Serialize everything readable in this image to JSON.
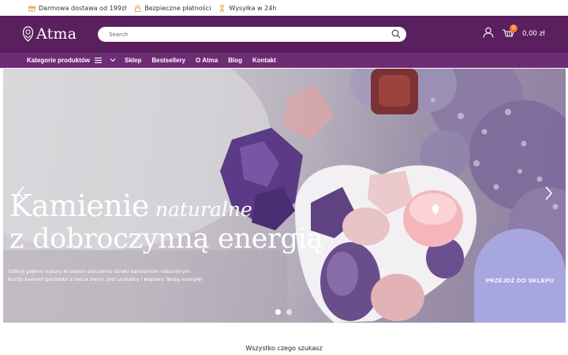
{
  "infobar": {
    "items": [
      {
        "label": "Darmowa dostawa od 199zł",
        "icon": "gift-icon"
      },
      {
        "label": "Bezpieczne płatności",
        "icon": "lock-icon"
      },
      {
        "label": "Wysyłka w 24h",
        "icon": "hourglass-icon"
      }
    ],
    "icon_color": "#e3a23a"
  },
  "header": {
    "logo_text": "Atma",
    "search_placeholder": "Search",
    "cart_count": "0",
    "cart_total": "0,00 zł",
    "background": "#5a1f5e"
  },
  "nav": {
    "categories_label": "Kategorie produktów",
    "links": [
      "Sklep",
      "Bestsellery",
      "O Atma",
      "Blog",
      "Kontakt"
    ],
    "background": "#6e2c74"
  },
  "hero": {
    "title_line1": "Kamienie",
    "title_script": "naturalne",
    "title_line2": "z dobroczynną energią",
    "desc_line1": "Odkryj piękno natury w swoim otoczeniu dzięki kamieniom naturalnym",
    "desc_line2": "Każdy kamień pochodzi z serca ziemi, jest unikalny i wspiera Twoją energię!",
    "cta_label": "PRZEJDŹ DO SKLEPU",
    "cta_color": "#a7a6df",
    "slides_total": 2,
    "active_slide": 1
  },
  "section": {
    "title": "Wszystko czego szukasz"
  }
}
